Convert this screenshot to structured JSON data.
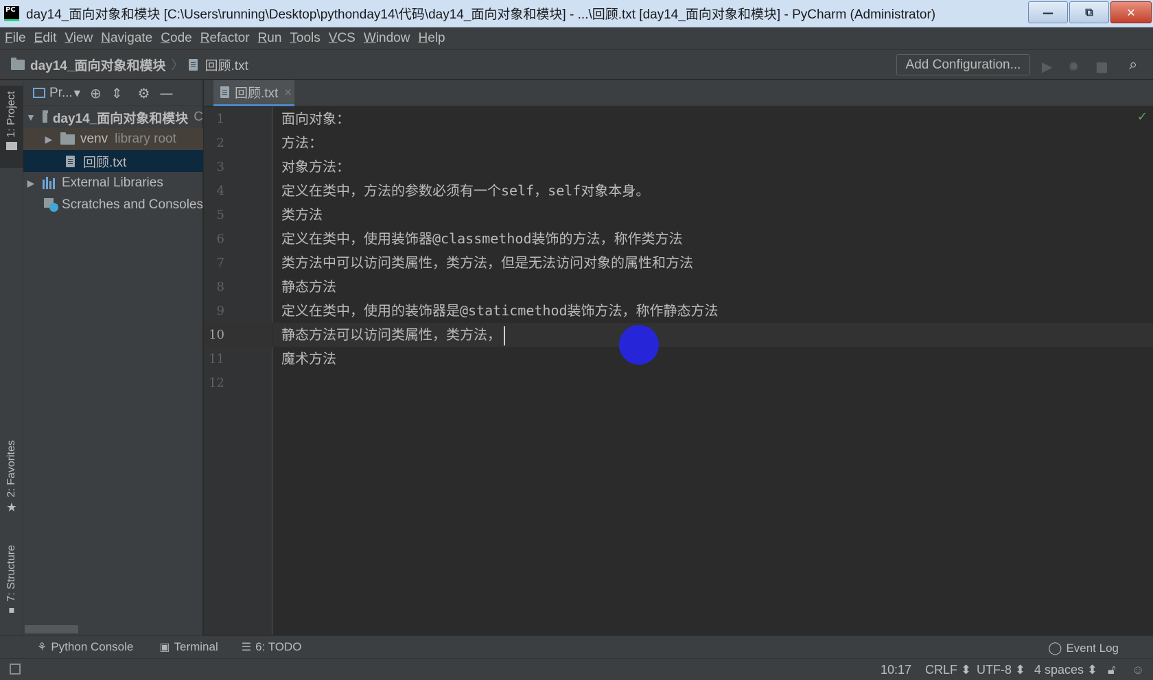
{
  "window": {
    "title": "day14_面向对象和模块 [C:\\Users\\running\\Desktop\\pythonday14\\代码\\day14_面向对象和模块] - ...\\回顾.txt [day14_面向对象和模块] - PyCharm (Administrator)",
    "app_logo": "PC",
    "minimize": "—",
    "restore": "⧉",
    "close": "✕"
  },
  "menu": [
    "File",
    "Edit",
    "View",
    "Navigate",
    "Code",
    "Refactor",
    "Run",
    "Tools",
    "VCS",
    "Window",
    "Help"
  ],
  "navbar": {
    "project": "day14_面向对象和模块",
    "separator": "〉",
    "file": "回顾.txt",
    "add_configuration": "Add Configuration..."
  },
  "left_stripe": {
    "project": "1: Project",
    "favorites": "2: Favorites",
    "structure": "7: Structure"
  },
  "project_panel": {
    "title": "Pr...",
    "tree": [
      {
        "label": "day14_面向对象和模块",
        "hint": "C"
      },
      {
        "label": "venv",
        "hint": "library root"
      },
      {
        "label": "回顾.txt"
      },
      {
        "label": "External Libraries"
      },
      {
        "label": "Scratches and Consoles"
      }
    ]
  },
  "editor": {
    "tab": "回顾.txt",
    "current_line": 10,
    "lines": [
      "面向对象：",
      "方法：",
      "对象方法：",
      "定义在类中，方法的参数必须有一个self，self对象本身。",
      "类方法",
      "定义在类中，使用装饰器@classmethod装饰的方法，称作类方法",
      "类方法中可以访问类属性，类方法，但是无法访问对象的属性和方法",
      "静态方法",
      "定义在类中，使用的装饰器是@staticmethod装饰方法，称作静态方法",
      "静态方法可以访问类属性，类方法，",
      "魔术方法",
      ""
    ],
    "line_numbers": [
      "1",
      "2",
      "3",
      "4",
      "5",
      "6",
      "7",
      "8",
      "9",
      "10",
      "11",
      "12"
    ]
  },
  "bottom_tools": {
    "python_console": "Python Console",
    "terminal": "Terminal",
    "todo": "6: TODO",
    "event_log": "Event Log"
  },
  "status": {
    "position": "10:17",
    "line_sep": "CRLF ⬍",
    "encoding": "UTF-8 ⬍",
    "indent": "4 spaces ⬍"
  },
  "colors": {
    "accent": "#4a88c7",
    "editor_bg": "#2b2b2b",
    "panel_bg": "#3c3f41",
    "selection": "#0d293e"
  }
}
